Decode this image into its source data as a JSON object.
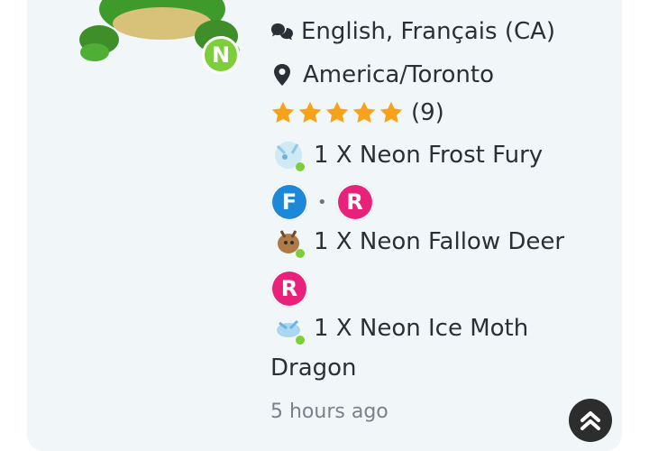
{
  "profile": {
    "avatar_badge": "N",
    "languages": "English, Français (CA)",
    "timezone": "America/Toronto",
    "rating": {
      "stars": 5,
      "count_label": "(9)"
    }
  },
  "listing": {
    "items": [
      {
        "label": "1 X Neon Frost Fury",
        "badges": [
          "F",
          "R"
        ]
      },
      {
        "label": "1 X Neon Fallow Deer",
        "badges": [
          "R"
        ]
      },
      {
        "label_line1": "1 X Neon Ice Moth",
        "label_line2": "Dragon",
        "badges": []
      }
    ],
    "time_ago": "5 hours ago"
  },
  "colors": {
    "badge_F": "#1e88d8",
    "badge_R": "#e8227a",
    "star": "#f7a21b",
    "neon_green": "#7ccf3a"
  }
}
